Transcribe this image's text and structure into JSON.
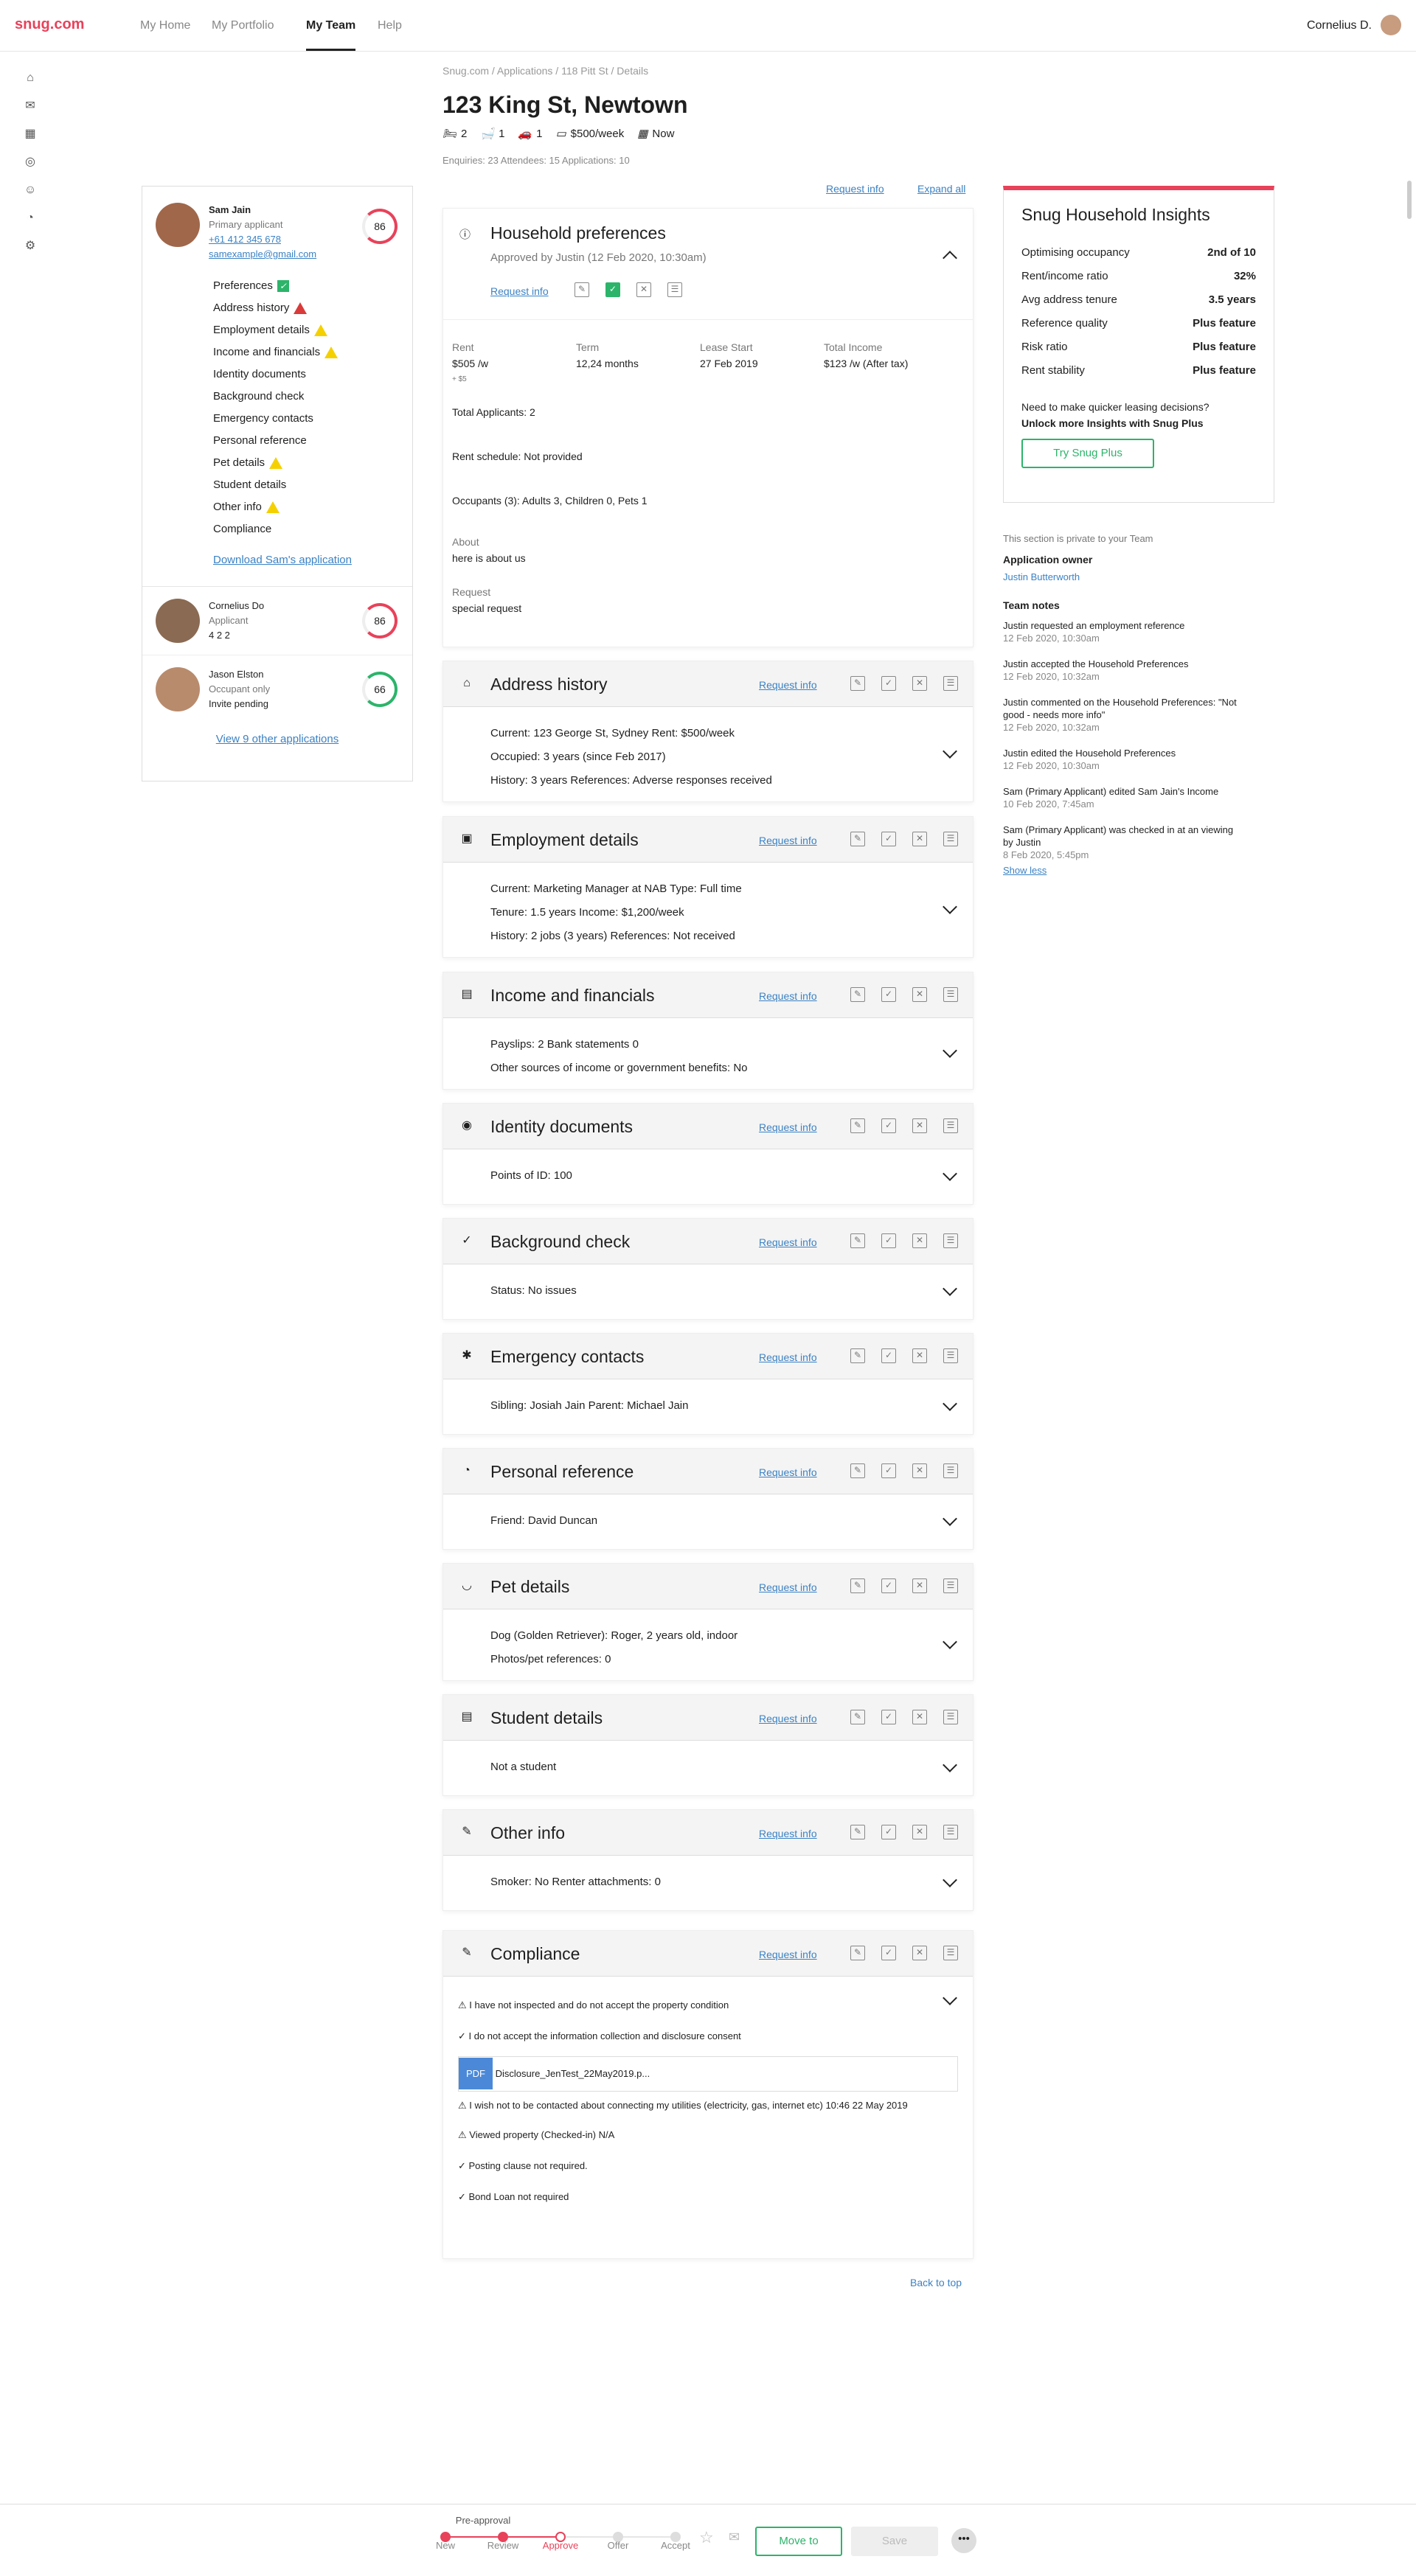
{
  "nav": {
    "logo": "snug.com",
    "items": [
      "My Home",
      "My Portfolio",
      "My Team",
      "Help"
    ],
    "user": "Cornelius D."
  },
  "breadcrumb": "Snug.com / Applications / 118 Pitt St / Details",
  "property": {
    "title": "123 King St, Newtown",
    "beds": "2",
    "baths": "1",
    "cars": "1",
    "rent": "$500/week",
    "available": "Now",
    "stats": "Enquiries: 23   Attendees: 15   Applications: 10"
  },
  "applicant": {
    "name": "Sam Jain",
    "role": "Primary applicant",
    "phone": "+61 412 345 678",
    "email": "samexample@gmail.com",
    "score": "86",
    "sections": [
      "Preferences",
      "Address history",
      "Employment details",
      "Income and financials",
      "Identity documents",
      "Background check",
      "Emergency contacts",
      "Personal reference",
      "Pet details",
      "Student details",
      "Other info",
      "Compliance"
    ],
    "download": "Download Sam's application"
  },
  "others": [
    {
      "name": "Cornelius Do",
      "role": "Applicant",
      "counts": "4   2   2",
      "score": "86"
    },
    {
      "name": "Jason Elston",
      "role": "Occupant only",
      "sub": "Invite pending",
      "score": "66"
    }
  ],
  "view_other": "View 9 other applications",
  "links": {
    "request_info": "Request info",
    "expand_all": "Expand all"
  },
  "household": {
    "title": "Household preferences",
    "approved": "Approved by Justin (12 Feb 2020, 10:30am)",
    "rent_label": "Rent",
    "rent": "$505 /w",
    "rent_sub": "+ $5",
    "term_label": "Term",
    "term": "12,24 months",
    "lease_label": "Lease Start",
    "lease": "27 Feb 2019",
    "income_label": "Total Income",
    "income": "$123 /w (After tax)",
    "applicants": "Total Applicants:  2",
    "schedule": "Rent schedule:  Not provided",
    "occupants": "Occupants (3):  Adults 3, Children 0, Pets 1",
    "about_label": "About",
    "about": "here is about us",
    "request_label": "Request",
    "request": "special request"
  },
  "cards": [
    {
      "title": "Address history",
      "lines": [
        "Current: 123 George St, Sydney     Rent: $500/week",
        "Occupied: 3 years (since Feb 2017)",
        "History: 3 years                       References: Adverse responses received"
      ]
    },
    {
      "title": "Employment details",
      "lines": [
        "Current: Marketing Manager at NAB     Type: Full time",
        "Tenure: 1.5 years     Income: $1,200/week",
        "History: 2 jobs (3 years)        References: Not received"
      ]
    },
    {
      "title": "Income and financials",
      "lines": [
        "Payslips: 2     Bank statements 0",
        "Other sources of income or government benefits: No"
      ]
    },
    {
      "title": "Identity documents",
      "lines": [
        "Points of ID: 100"
      ]
    },
    {
      "title": "Background check",
      "lines": [
        "Status: No issues"
      ]
    },
    {
      "title": "Emergency contacts",
      "lines": [
        "Sibling: Josiah Jain     Parent: Michael Jain"
      ]
    },
    {
      "title": "Personal reference",
      "lines": [
        "Friend: David Duncan"
      ]
    },
    {
      "title": "Pet details",
      "lines": [
        "Dog (Golden Retriever): Roger, 2 years old, indoor",
        "Photos/pet references: 0"
      ]
    },
    {
      "title": "Student details",
      "lines": [
        "Not a student"
      ]
    },
    {
      "title": "Other info",
      "lines": [
        "Smoker: No     Renter attachments: 0"
      ]
    }
  ],
  "compliance": {
    "title": "Compliance",
    "items": [
      "I have not inspected and do not accept the property condition",
      "I do not accept the information collection and disclosure consent",
      "Disclosure_JenTest_22May2019.p...",
      "I wish not to be contacted about connecting my utilities (electricity, gas, internet etc) 10:46 22 May 2019",
      "Viewed property (Checked-in) N/A",
      "Posting clause not required.",
      "Bond Loan not required"
    ],
    "pdf": "PDF"
  },
  "back_to_top": "Back to top",
  "insights": {
    "title": "Snug Household Insights",
    "rows": [
      [
        "Optimising occupancy",
        "2nd of 10"
      ],
      [
        "Rent/income ratio",
        "32%"
      ],
      [
        "Avg address tenure",
        "3.5 years"
      ],
      [
        "Reference quality",
        "Plus feature"
      ],
      [
        "Risk ratio",
        "Plus feature"
      ],
      [
        "Rent stability",
        "Plus feature"
      ]
    ],
    "cta1": "Need to make quicker leasing decisions?",
    "cta2": "Unlock more Insights with Snug Plus",
    "button": "Try Snug Plus"
  },
  "team": {
    "private": "This section is private to your Team",
    "owner_label": "Application owner",
    "owner": "Justin Butterworth",
    "notes_label": "Team notes",
    "notes": [
      [
        "Justin requested an employment reference",
        "12 Feb 2020, 10:30am"
      ],
      [
        "Justin accepted the Household Preferences",
        "12 Feb 2020, 10:32am"
      ],
      [
        "Justin commented on the Household Preferences: \"Not good - needs more info\"",
        "12 Feb 2020, 10:32am"
      ],
      [
        "Justin edited the Household Preferences",
        "12 Feb 2020, 10:30am"
      ],
      [
        "Sam (Primary Applicant) edited Sam Jain's Income",
        "10 Feb 2020, 7:45am"
      ],
      [
        "Sam (Primary Applicant) was checked in at an viewing by Justin",
        "8 Feb 2020, 5:45pm"
      ]
    ],
    "show_less": "Show less"
  },
  "progress": {
    "steps": [
      "New",
      "Review",
      "Approve",
      "Offer",
      "Accept"
    ],
    "pre": "Pre-approval",
    "move": "Move to",
    "save": "Save"
  }
}
